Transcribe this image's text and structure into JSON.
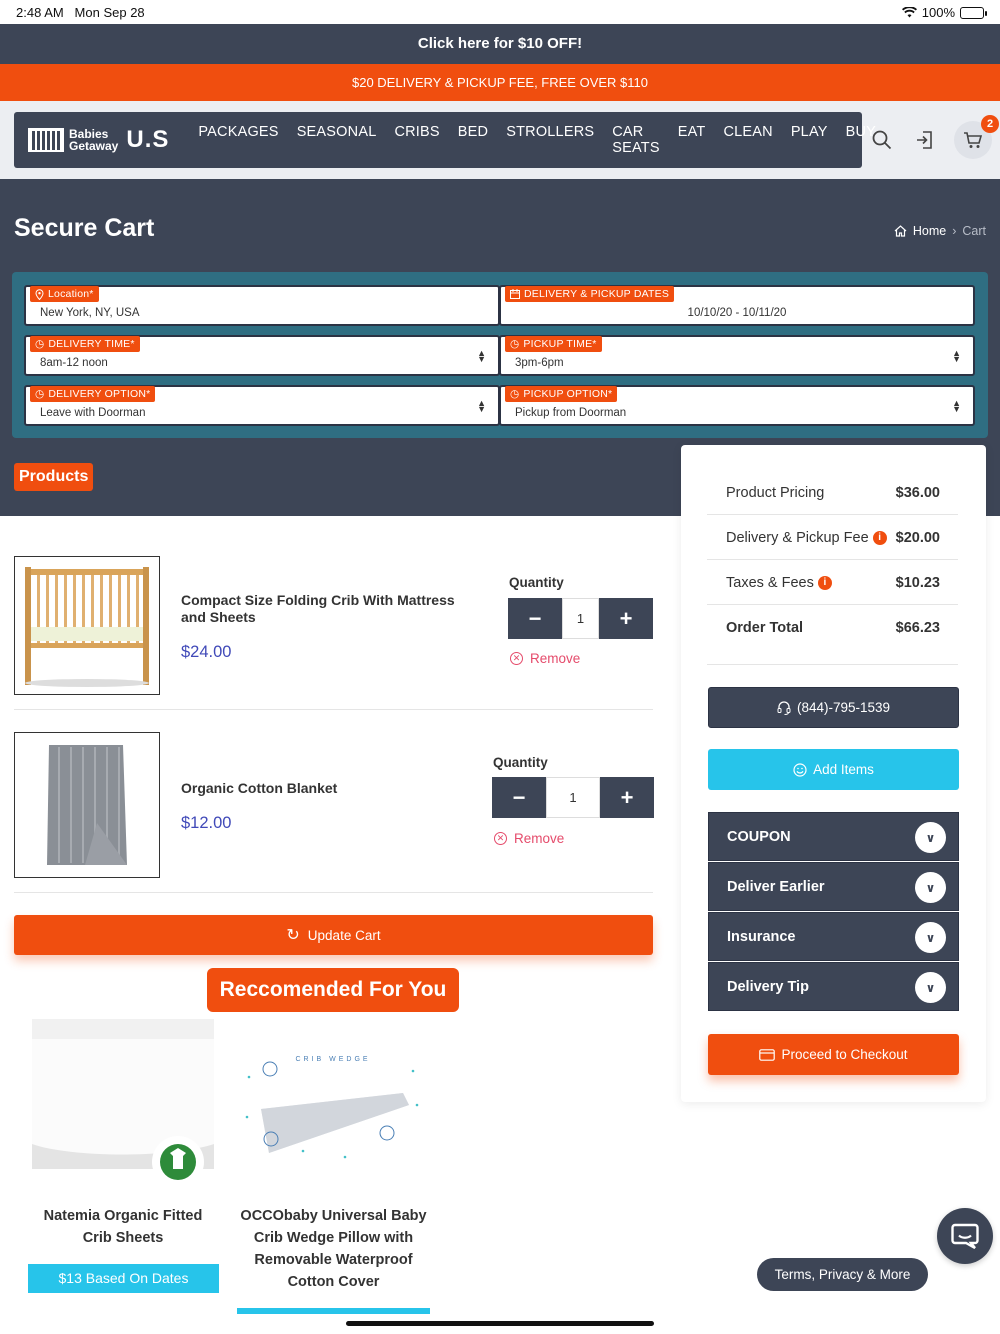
{
  "status_bar": {
    "time": "2:48 AM",
    "date": "Mon Sep 28",
    "battery": "100%"
  },
  "promo": {
    "offer": "Click here for $10 OFF!",
    "delivery": "$20 DELIVERY & PICKUP FEE, FREE OVER $110"
  },
  "logo": {
    "line1": "Babies",
    "line2": "Getaway",
    "suffix": "U.S"
  },
  "nav": [
    "PACKAGES",
    "SEASONAL",
    "CRIBS",
    "BED",
    "STROLLERS",
    "CAR SEATS",
    "EAT",
    "CLEAN",
    "PLAY",
    "BUY"
  ],
  "cart_count": "2",
  "page": {
    "title": "Secure Cart",
    "breadcrumb_home": "Home",
    "breadcrumb_current": "Cart"
  },
  "form": {
    "location": {
      "label": "Location*",
      "value": "New York, NY, USA"
    },
    "dates": {
      "label": "DELIVERY & PICKUP DATES",
      "value": "10/10/20 - 10/11/20"
    },
    "delivery_time": {
      "label": "DELIVERY TIME*",
      "value": "8am-12 noon"
    },
    "pickup_time": {
      "label": "PICKUP TIME*",
      "value": "3pm-6pm"
    },
    "delivery_option": {
      "label": "DELIVERY OPTION*",
      "value": "Leave with Doorman"
    },
    "pickup_option": {
      "label": "PICKUP OPTION*",
      "value": "Pickup from Doorman"
    }
  },
  "products_label": "Products",
  "items": [
    {
      "name": "Compact Size Folding Crib With Mattress and Sheets",
      "price": "$24.00",
      "qty_label": "Quantity",
      "qty": "1",
      "remove": "Remove"
    },
    {
      "name": "Organic Cotton Blanket",
      "price": "$12.00",
      "qty_label": "Quantity",
      "qty": "1",
      "remove": "Remove"
    }
  ],
  "update_cart": "Update Cart",
  "summary": {
    "product_pricing_label": "Product Pricing",
    "product_pricing": "$36.00",
    "fee_label": "Delivery & Pickup Fee",
    "fee": "$20.00",
    "taxes_label": "Taxes & Fees",
    "taxes": "$10.23",
    "total_label": "Order Total",
    "total": "$66.23"
  },
  "buttons": {
    "phone": "(844)-795-1539",
    "add_items": "Add Items",
    "checkout": "Proceed to Checkout"
  },
  "accordion": [
    "COUPON",
    "Deliver Earlier",
    "Insurance",
    "Delivery Tip"
  ],
  "recommended": {
    "title": "Reccomended For You",
    "items": [
      {
        "name": "Natemia Organic Fitted Crib Sheets",
        "price": "$13 Based On Dates"
      },
      {
        "name": "OCCObaby Universal Baby Crib Wedge Pillow with Removable Waterproof Cotton Cover",
        "image_text": "CRIB WEDGE"
      }
    ]
  },
  "terms": "Terms, Privacy & More"
}
